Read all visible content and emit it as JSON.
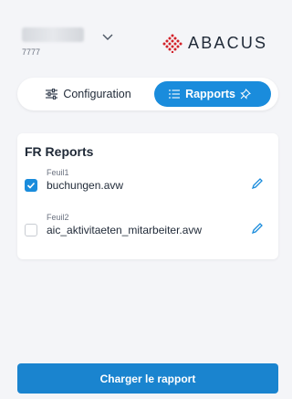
{
  "account": {
    "id": "7777"
  },
  "brand": {
    "name": "ABACUS",
    "accent": "#d3222a"
  },
  "mode_switch": {
    "configuration_label": "Configuration",
    "rapports_label": "Rapports",
    "active": "rapports",
    "active_color": "#1a8cdc"
  },
  "reports_panel": {
    "title": "FR Reports",
    "items": [
      {
        "sheet": "Feuil1",
        "file": "buchungen.avw",
        "checked": true
      },
      {
        "sheet": "Feuil2",
        "file": "aic_aktivitaeten_mitarbeiter.avw",
        "checked": false
      }
    ]
  },
  "actions": {
    "load_label": "Charger le rapport"
  },
  "icons": {
    "account_menu": "chevron-down-icon",
    "configuration": "sliders-icon",
    "rapports": "list-icon",
    "pin": "pin-icon",
    "edit": "pencil-icon",
    "check": "checkmark-icon"
  }
}
